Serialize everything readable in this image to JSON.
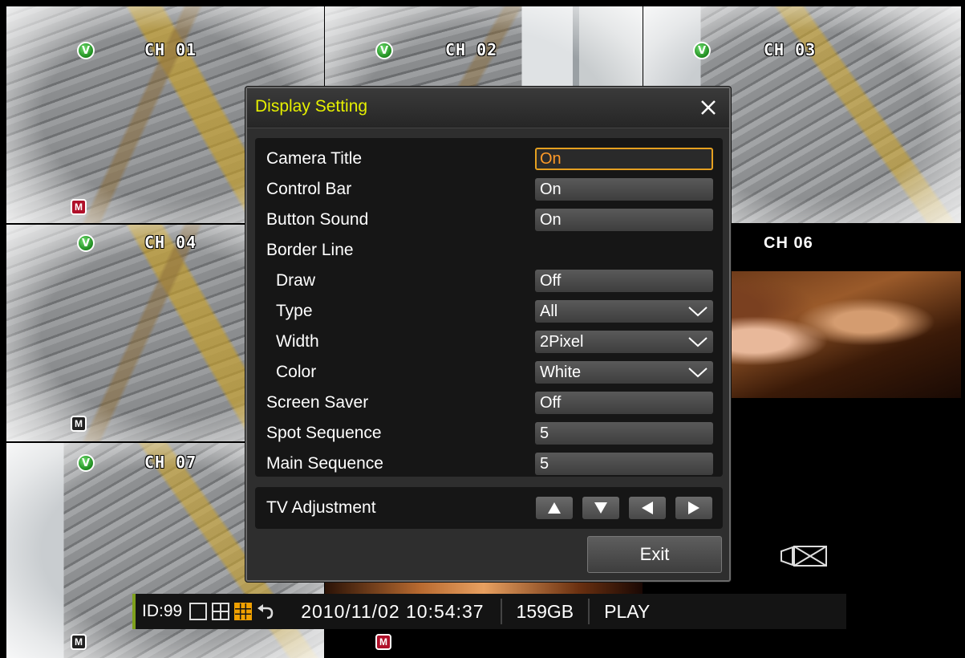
{
  "cameras": [
    {
      "label": "CH 01"
    },
    {
      "label": "CH 02"
    },
    {
      "label": "CH 03"
    },
    {
      "label": "CH 04"
    },
    {
      "label": "CH 06"
    },
    {
      "label": "CH 07"
    }
  ],
  "status_icons": {
    "live": "V",
    "motion": "M"
  },
  "status_bar": {
    "id": "ID:99",
    "datetime": "2010/11/02 10:54:37",
    "storage": "159GB",
    "mode": "PLAY"
  },
  "dialog": {
    "title": "Display Setting",
    "settings": [
      {
        "label": "Camera Title",
        "value": "On",
        "focused": true
      },
      {
        "label": "Control Bar",
        "value": "On"
      },
      {
        "label": "Button Sound",
        "value": "On"
      },
      {
        "label": "Border Line",
        "value": null
      },
      {
        "label": "Draw",
        "value": "Off"
      },
      {
        "label": "Type",
        "value": "All",
        "dropdown": true
      },
      {
        "label": "Width",
        "value": "2Pixel",
        "dropdown": true
      },
      {
        "label": "Color",
        "value": "White",
        "dropdown": true
      },
      {
        "label": "Screen Saver",
        "value": "Off"
      },
      {
        "label": "Spot Sequence",
        "value": "5"
      },
      {
        "label": "Main Sequence",
        "value": "5"
      }
    ],
    "tv_adjustment_label": "TV Adjustment",
    "exit_label": "Exit"
  },
  "colors": {
    "title_text": "#e6f000",
    "focus_border": "#e5a020",
    "status_accent": "#7fa01c",
    "grid_active": "#f0a000"
  }
}
